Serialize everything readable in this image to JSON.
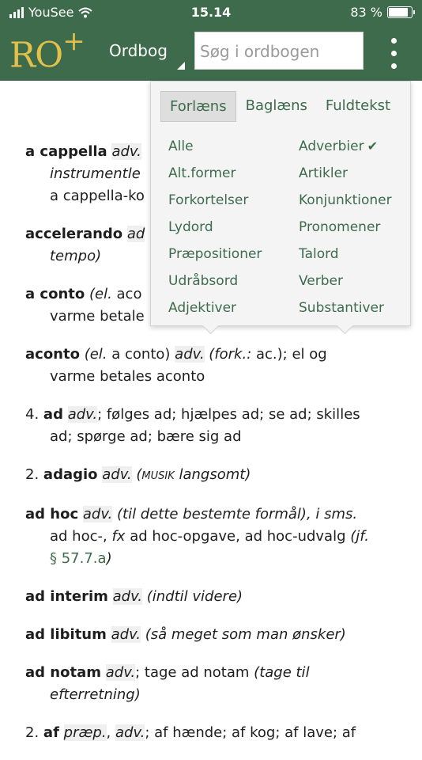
{
  "status_bar": {
    "carrier": "YouSee",
    "time": "15.14",
    "battery": "83 %"
  },
  "header": {
    "logo_text": "RO",
    "logo_plus": "+",
    "section_label": "Ordbog",
    "search_placeholder": "Søg i ordbogen",
    "menu_icon": "kebab-menu-icon"
  },
  "dropdown": {
    "tabs": [
      "Forlæns",
      "Baglæns",
      "Fuldtekst"
    ],
    "active_tab": "Forlæns",
    "categories_left": [
      "Alle",
      "Alt.former",
      "Forkortelser",
      "Lydord",
      "Præpositioner",
      "Udråbsord",
      "Adjektiver"
    ],
    "categories_right": [
      "Adverbier",
      "Artikler",
      "Konjunktioner",
      "Pronomener",
      "Talord",
      "Verber",
      "Substantiver"
    ],
    "selected": "Adverbier",
    "check_icon": "checkmark-icon"
  },
  "entries": {
    "e1": {
      "headword": "a cappella",
      "pos": "adv.",
      "line2": "instrumentle",
      "line3": "a cappella-ko"
    },
    "e2": {
      "headword": "accelerando",
      "pos": "ad",
      "line2": "tempo)"
    },
    "e3": {
      "headword": "a conto",
      "pre": "(el.",
      "mid": "aco",
      "line2": "varme betale"
    },
    "e4": {
      "headword": "aconto",
      "el": "(el.",
      "alt": "a conto)",
      "pos": "adv.",
      "fork": "(fork.:",
      "abbr": "ac.)",
      "rest": "; el og",
      "line2": "varme betales aconto"
    },
    "e5": {
      "num": "4.",
      "headword": "ad",
      "pos": "adv.",
      "rest": "; følges ad; hjælpes ad; se ad; skilles",
      "line2": "ad; spørge ad; bære sig ad"
    },
    "e6": {
      "num": "2.",
      "headword": "adagio",
      "pos": "adv.",
      "label": "MUSIK",
      "gloss": "langsomt)"
    },
    "e7": {
      "headword": "ad hoc",
      "pos": "adv.",
      "gloss": "(til dette bestemte formål),",
      "sms": "i sms.",
      "line2a": "ad hoc-,",
      "fx": "fx",
      "line2b": "ad hoc-opgave, ad hoc-udvalg",
      "jf": "(jf.",
      "link": "§ 57.7.a",
      "close": ")"
    },
    "e8": {
      "headword": "ad interim",
      "pos": "adv.",
      "gloss": "(indtil videre)"
    },
    "e9": {
      "headword": "ad libitum",
      "pos": "adv.",
      "gloss": "(så meget som man ønsker)"
    },
    "e10": {
      "headword": "ad notam",
      "pos": "adv.",
      "rest": "; tage ad notam",
      "gloss": "(tage til",
      "line2": "efterretning)"
    },
    "e11": {
      "num": "2.",
      "headword": "af",
      "pos1": "præp.",
      "pos2": "adv.",
      "rest": "; af hænde; af kog; af lave; af"
    }
  }
}
